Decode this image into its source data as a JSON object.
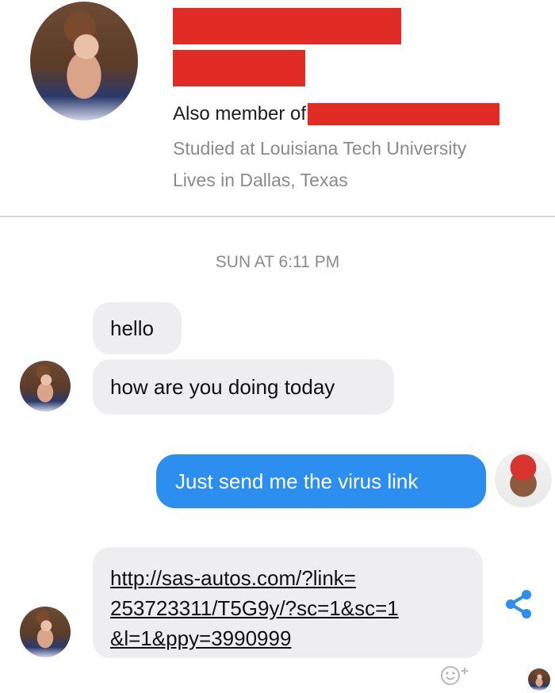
{
  "profile": {
    "also_member_label": "Also member of",
    "studied": "Studied at Louisiana Tech University",
    "lives": "Lives in Dallas, Texas"
  },
  "timestamp": "SUN AT 6:11 PM",
  "messages": [
    {
      "from": "other",
      "text": "hello"
    },
    {
      "from": "other",
      "text": "how are you doing today"
    },
    {
      "from": "me",
      "text": "Just send me the virus link"
    },
    {
      "from": "other",
      "lines": [
        "http://sas-autos.com/?link=",
        "253723311/T5G9y/?sc=1&sc=1",
        "&l=1&ppy=3990999"
      ]
    }
  ],
  "icons": {
    "share": "share-icon",
    "reaction": "emoji-reaction-icon"
  },
  "colors": {
    "outgoing_bubble": "#2c8ff0",
    "incoming_bubble": "#eeeef0",
    "redaction": "#e32b25",
    "secondary_text": "#8a8a8a"
  }
}
